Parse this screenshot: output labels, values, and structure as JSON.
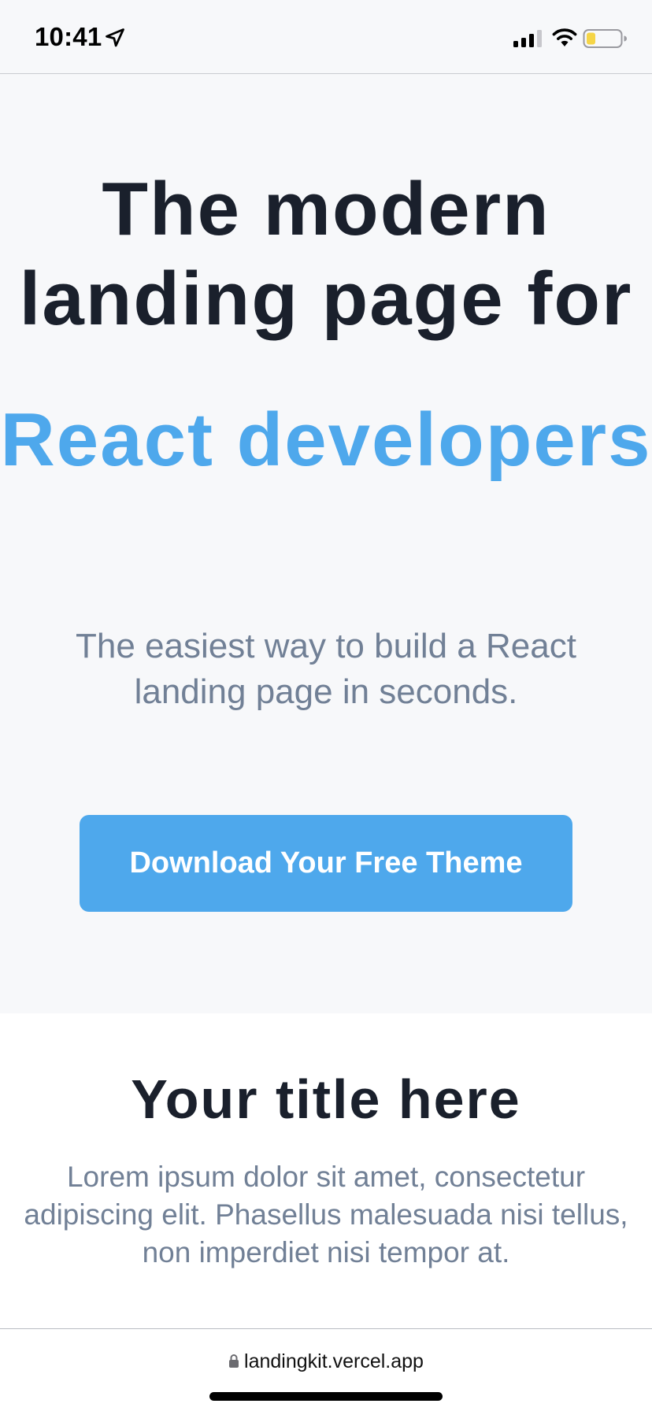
{
  "status_bar": {
    "time": "10:41",
    "icons": [
      "location-arrow-icon",
      "cellular-signal-icon",
      "wifi-icon",
      "battery-icon"
    ],
    "battery_color": "#f5d547"
  },
  "hero": {
    "title": "The modern landing page for",
    "highlight": "React developers",
    "subtitle": "The easiest way to build a React landing page in seconds.",
    "cta_label": "Download Your Free Theme",
    "accent_color": "#4ea8ec"
  },
  "section": {
    "title": "Your title here",
    "body": "Lorem ipsum dolor sit amet, consectetur adipiscing elit. Phasellus malesuada nisi tellus, non imperdiet nisi tempor at."
  },
  "browser": {
    "url": "landingkit.vercel.app"
  }
}
